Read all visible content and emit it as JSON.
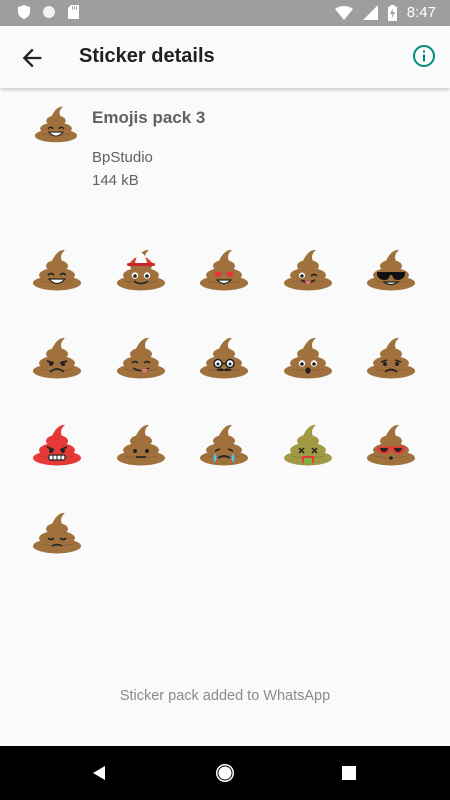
{
  "status_bar": {
    "time": "8:47",
    "icons": [
      "shield-icon",
      "circle-icon",
      "sd-card-icon",
      "wifi-icon",
      "signal-icon",
      "battery-charging-icon"
    ]
  },
  "app_bar": {
    "title": "Sticker details",
    "back_icon": "arrow-back-icon",
    "info_icon": "info-icon",
    "accent_color": "#00897b"
  },
  "pack": {
    "name": "Emojis pack 3",
    "publisher": "BpStudio",
    "size": "144 kB"
  },
  "stickers": [
    {
      "name": "smiling-poop-sticker",
      "face": "smile",
      "color": "#a0713d"
    },
    {
      "name": "cap-poop-sticker",
      "face": "cap",
      "color": "#a0713d"
    },
    {
      "name": "heart-eyes-poop-sticker",
      "face": "hearts",
      "color": "#a0713d"
    },
    {
      "name": "tongue-wink-poop-sticker",
      "face": "tongue",
      "color": "#a0713d"
    },
    {
      "name": "sunglasses-poop-sticker",
      "face": "sunglasses",
      "color": "#a0713d"
    },
    {
      "name": "angry-poop-sticker",
      "face": "angry",
      "color": "#a0713d"
    },
    {
      "name": "tongue-out-poop-sticker",
      "face": "tongue2",
      "color": "#a0713d"
    },
    {
      "name": "glasses-mustache-poop-sticker",
      "face": "glasses",
      "color": "#a0713d"
    },
    {
      "name": "surprised-poop-sticker",
      "face": "surprised",
      "color": "#a0713d"
    },
    {
      "name": "frowning-poop-sticker",
      "face": "frown",
      "color": "#a0713d"
    },
    {
      "name": "red-angry-poop-sticker",
      "face": "grit",
      "color": "#e53935"
    },
    {
      "name": "neutral-poop-sticker",
      "face": "neutral",
      "color": "#a0713d"
    },
    {
      "name": "crying-poop-sticker",
      "face": "cry",
      "color": "#a0713d"
    },
    {
      "name": "sick-poop-sticker",
      "face": "sick",
      "color": "#a09a45"
    },
    {
      "name": "red-glasses-poop-sticker",
      "face": "redglasses",
      "color": "#a0713d"
    },
    {
      "name": "sleepy-poop-sticker",
      "face": "sleepy",
      "color": "#a0713d"
    }
  ],
  "footer": {
    "message": "Sticker pack added to WhatsApp"
  },
  "nav_bar": {
    "icons": [
      "nav-back-icon",
      "nav-home-icon",
      "nav-recents-icon"
    ]
  }
}
